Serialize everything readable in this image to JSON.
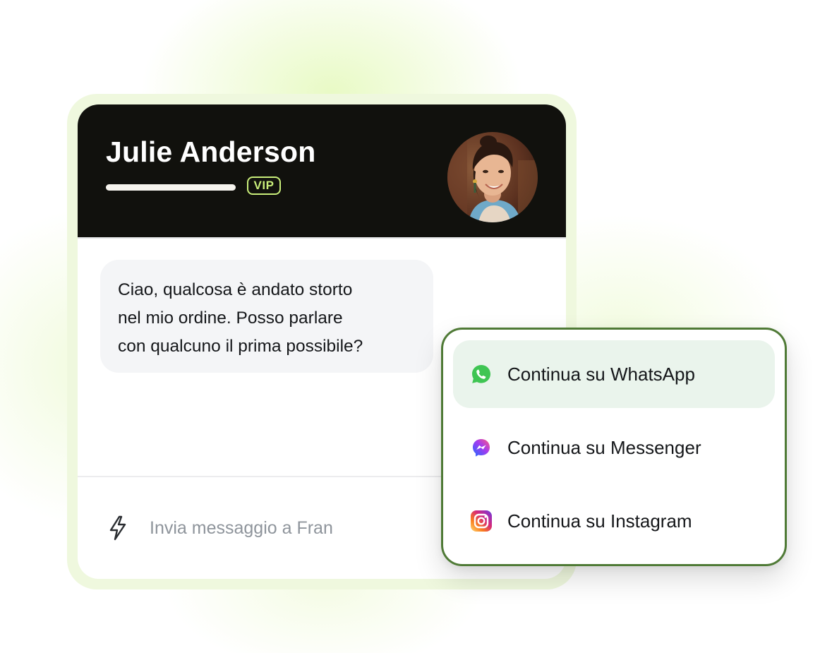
{
  "header": {
    "contact_name": "Julie Anderson",
    "badge": "VIP"
  },
  "conversation": {
    "message_lines": [
      "Ciao, qualcosa è andato storto",
      "nel mio ordine. Posso parlare",
      "con qualcuno il prima possibile?"
    ]
  },
  "composer": {
    "placeholder": "Invia messaggio a Fran",
    "icon": "lightning-bolt-icon"
  },
  "channel_menu": {
    "items": [
      {
        "label": "Continua su WhatsApp",
        "icon": "whatsapp-icon",
        "highlighted": true
      },
      {
        "label": "Continua su Messenger",
        "icon": "messenger-icon",
        "highlighted": false
      },
      {
        "label": "Continua su Instagram",
        "icon": "instagram-icon",
        "highlighted": false
      }
    ]
  },
  "colors": {
    "header_bg": "#11110d",
    "badge_accent": "#c9ee7a",
    "menu_border": "#4f7a36",
    "active_item_bg": "#eaf4ec",
    "bubble_bg": "#f4f5f7"
  }
}
